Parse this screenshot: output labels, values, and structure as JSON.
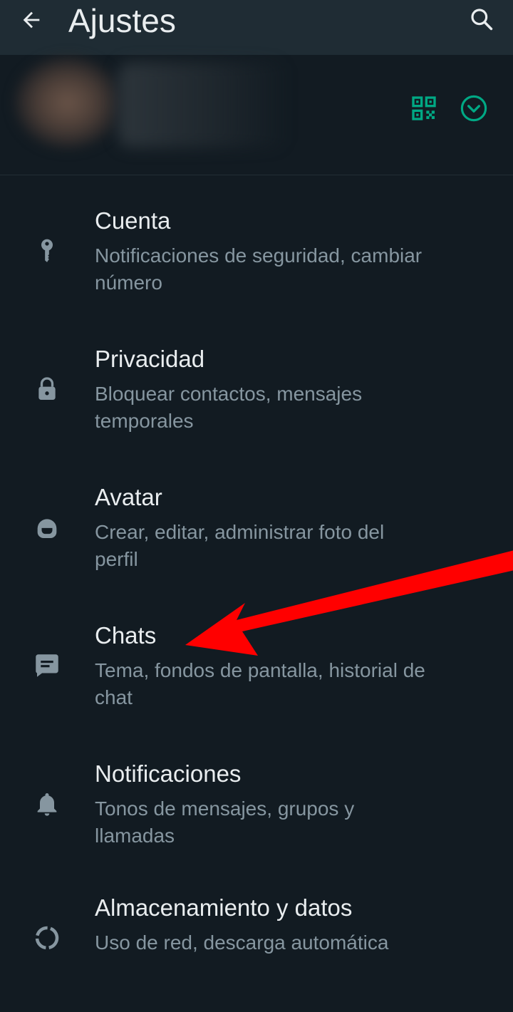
{
  "app_bar": {
    "title": "Ajustes",
    "back_icon": "arrow-left-icon",
    "search_icon": "search-icon"
  },
  "profile": {
    "qr_icon": "qr-code-icon",
    "expand_icon": "chevron-down-circle-icon",
    "accent_color": "#00a884"
  },
  "settings": [
    {
      "id": "cuenta",
      "icon": "key-icon",
      "title": "Cuenta",
      "subtitle": "Notificaciones de seguridad, cambiar número"
    },
    {
      "id": "privacidad",
      "icon": "lock-icon",
      "title": "Privacidad",
      "subtitle": "Bloquear contactos, mensajes temporales"
    },
    {
      "id": "avatar",
      "icon": "avatar-face-icon",
      "title": "Avatar",
      "subtitle": "Crear, editar, administrar foto del perfil"
    },
    {
      "id": "chats",
      "icon": "chat-bubble-icon",
      "title": "Chats",
      "subtitle": "Tema, fondos de pantalla, historial de chat"
    },
    {
      "id": "notificaciones",
      "icon": "bell-icon",
      "title": "Notificaciones",
      "subtitle": "Tonos de mensajes, grupos y llamadas"
    },
    {
      "id": "almacenamiento",
      "icon": "data-usage-icon",
      "title": "Almacenamiento y datos",
      "subtitle": "Uso de red, descarga automática"
    }
  ],
  "annotation": {
    "arrow_color": "#ff0000",
    "points_to": "Chats"
  }
}
